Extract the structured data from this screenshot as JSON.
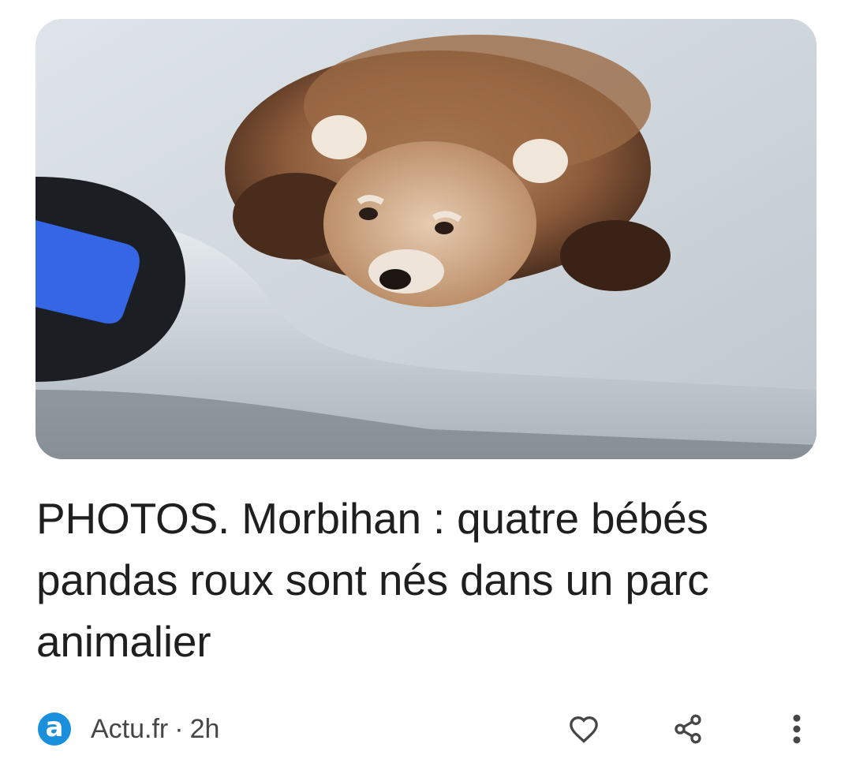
{
  "article": {
    "image_alt": "Bébé panda roux sur une balance",
    "headline": "PHOTOS. Morbihan : quatre bébés pandas roux sont nés dans un parc animalier"
  },
  "meta": {
    "source_logo_letter": "a",
    "source_name": "Actu.fr",
    "separator": "·",
    "age": "2h"
  },
  "icons": {
    "like": "heart-outline-icon",
    "share": "share-icon",
    "more": "more-vert-icon"
  },
  "colors": {
    "headline": "#1f1f1f",
    "meta_text": "#444746",
    "source_brand": "#1a8fdc"
  }
}
